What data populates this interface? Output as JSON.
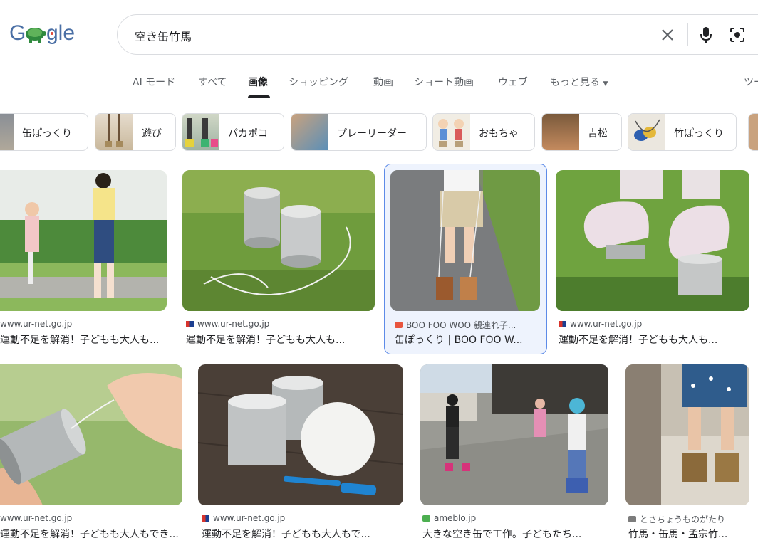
{
  "search": {
    "query": "空き缶竹馬"
  },
  "tabs": [
    "AI モード",
    "すべて",
    "画像",
    "ショッピング",
    "動画",
    "ショート動画",
    "ウェブ",
    "もっと見る",
    "ツー"
  ],
  "chips": [
    "缶ぽっくり",
    "遊び",
    "パカポコ",
    "プレーリーダー",
    "おもちゃ",
    "吉松",
    "竹ぽっくり"
  ],
  "results": [
    {
      "source": "www.ur-net.go.jp",
      "title": "運動不足を解消！子どもも大人も..."
    },
    {
      "source": "www.ur-net.go.jp",
      "title": "運動不足を解消！子どもも大人も..."
    },
    {
      "source": "BOO FOO WOO 親連れ子...",
      "title": "缶ぽっくり | BOO FOO W..."
    },
    {
      "source": "www.ur-net.go.jp",
      "title": "運動不足を解消！子どもも大人も..."
    },
    {
      "source": "www.ur-net.go.jp",
      "title": "運動不足を解消！子どもも大人もでき..."
    },
    {
      "source": "www.ur-net.go.jp",
      "title": "運動不足を解消！子どもも大人もで..."
    },
    {
      "source": "ameblo.jp",
      "title": "大きな空き缶で工作。子どもたち..."
    },
    {
      "source": "とさちょうものがたり",
      "title": "竹馬・缶馬・孟宗竹..."
    }
  ],
  "colors": {
    "accent": "#1a73e8",
    "selected_border": "#5d8be8",
    "text": "#202124",
    "muted": "#5f6368"
  }
}
